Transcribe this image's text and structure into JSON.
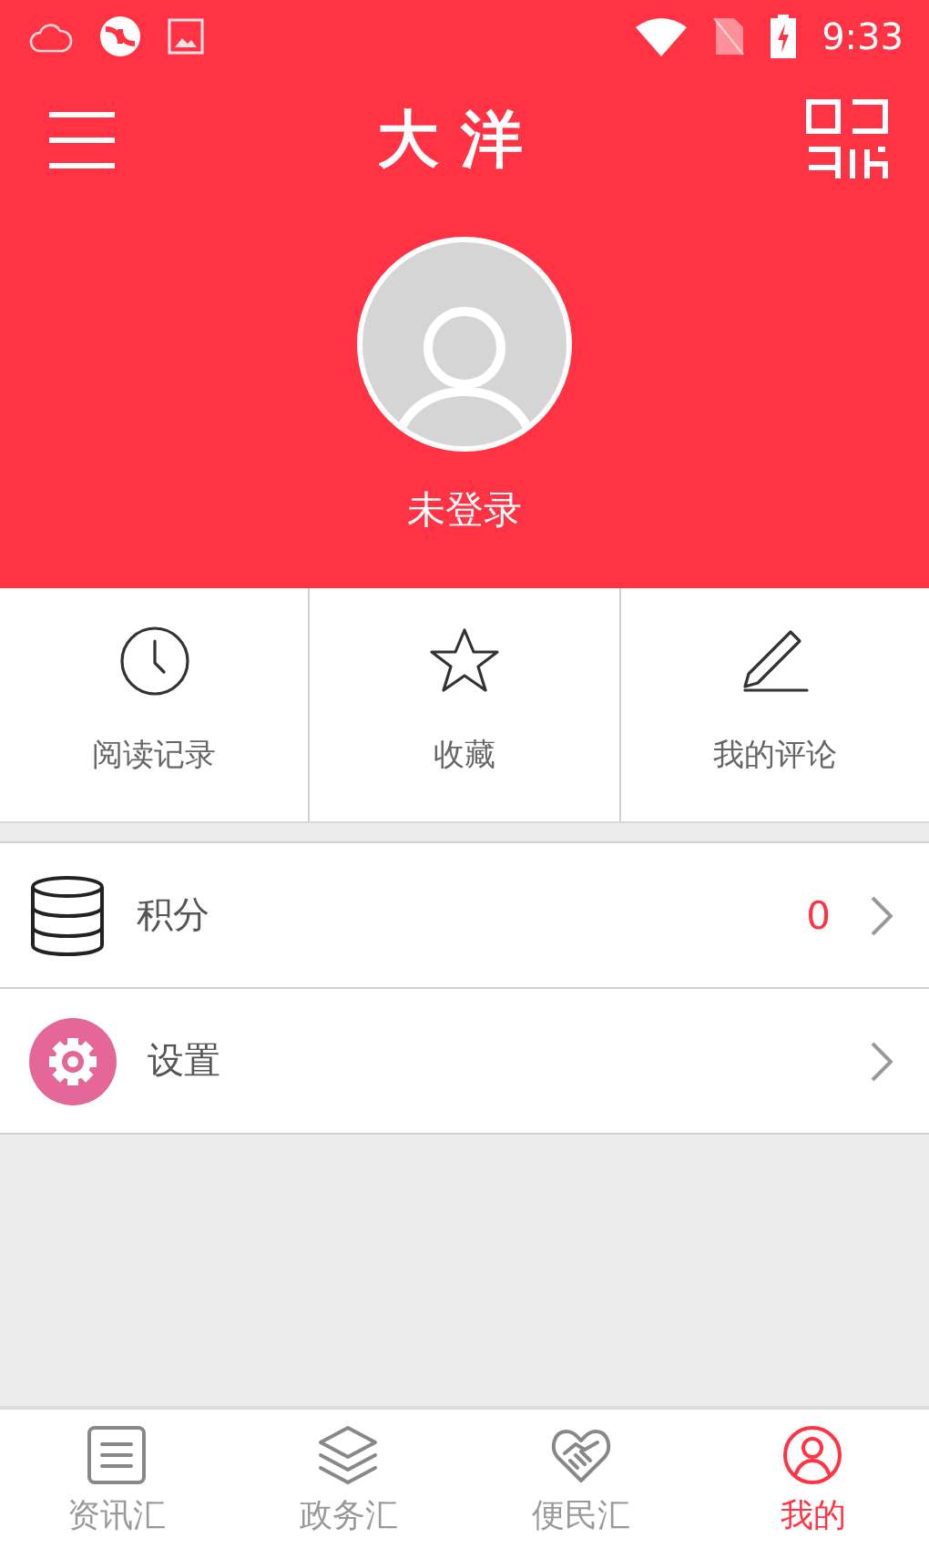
{
  "status_bar": {
    "time": "9:33"
  },
  "header": {
    "title": "大洋"
  },
  "profile": {
    "login_label": "未登录"
  },
  "quick_actions": [
    {
      "kind": "history",
      "label": "阅读记录"
    },
    {
      "kind": "favorites",
      "label": "收藏"
    },
    {
      "kind": "comments",
      "label": "我的评论"
    }
  ],
  "menu": [
    {
      "kind": "points",
      "label": "积分",
      "value": "0"
    },
    {
      "kind": "settings",
      "label": "设置"
    }
  ],
  "bottom_nav": [
    {
      "kind": "news",
      "label": "资讯汇",
      "selected": false
    },
    {
      "kind": "government",
      "label": "政务汇",
      "selected": false
    },
    {
      "kind": "services",
      "label": "便民汇",
      "selected": false
    },
    {
      "kind": "me",
      "label": "我的",
      "selected": true
    }
  ]
}
